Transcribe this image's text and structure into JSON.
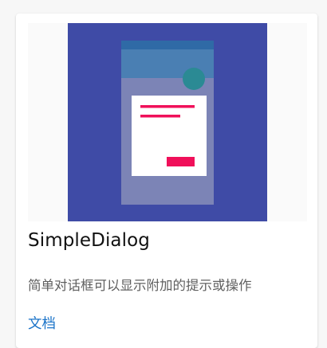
{
  "card": {
    "title": "SimpleDialog",
    "description": "简单对话框可以显示附加的提示或操作",
    "link_label": "文档"
  },
  "illustration": {
    "subject": "simple-dialog-illustration",
    "colors": {
      "background": "#3f4ba6",
      "phone_body": "#7c84b6",
      "phone_top": "#4a7fb3",
      "phone_status_bar": "#2f6aa6",
      "avatar": "#2b8a94",
      "dialog": "#ffffff",
      "accent": "#f0105a"
    }
  }
}
